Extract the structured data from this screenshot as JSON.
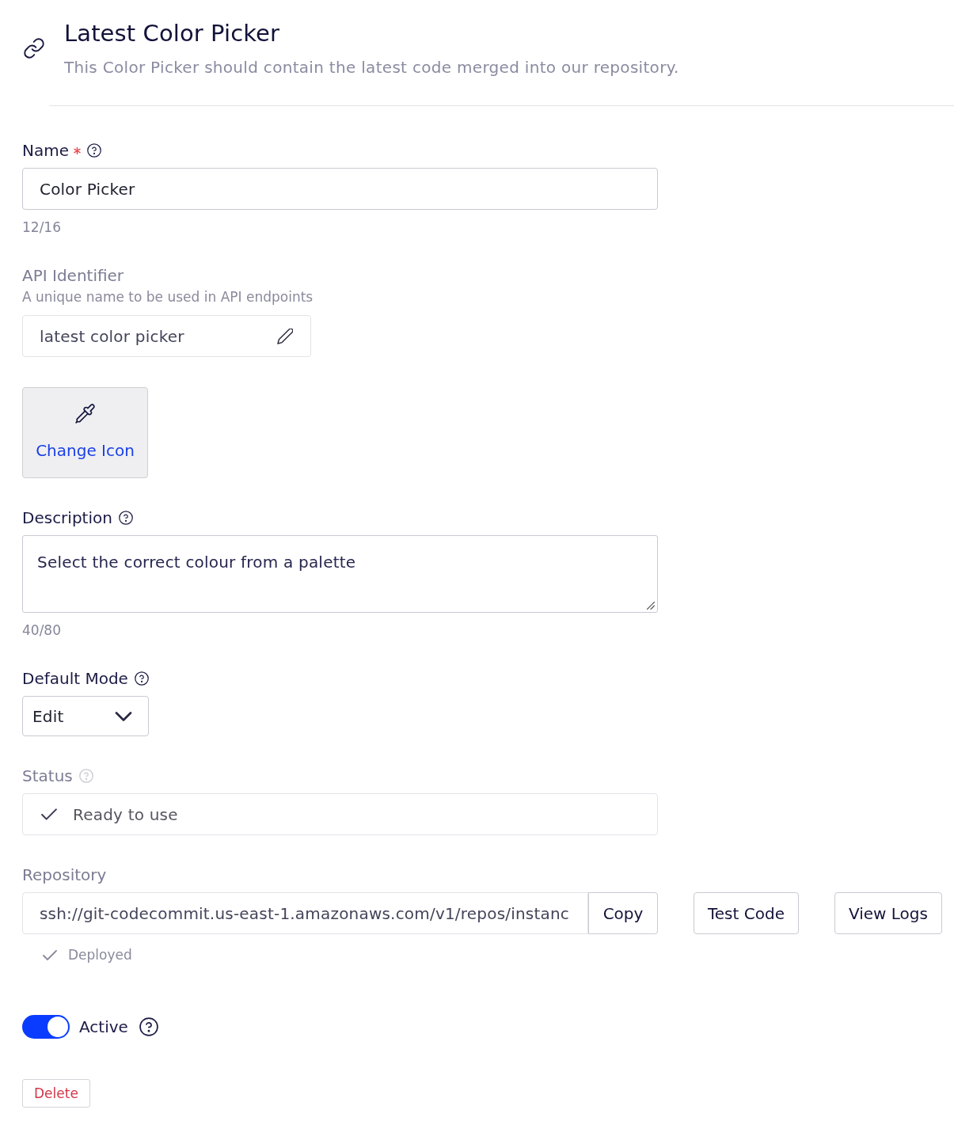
{
  "header": {
    "title": "Latest Color Picker",
    "subtitle": "This Color Picker should contain the latest code merged into our repository."
  },
  "form": [
    {
      "kind": "text",
      "label": "Name",
      "required": true,
      "help": true,
      "disabled": false,
      "value": "Color Picker",
      "counter": "12/16"
    },
    {
      "kind": "identifier",
      "label": "API Identifier",
      "required": false,
      "help": false,
      "disabled": true,
      "hint": "A unique name to be used in API endpoints",
      "value": "latest color picker"
    },
    {
      "kind": "icon_picker",
      "button": "Change Icon"
    },
    {
      "kind": "textarea",
      "label": "Description",
      "required": false,
      "help": true,
      "disabled": false,
      "value": "Select the correct colour from a palette",
      "counter": "40/80"
    },
    {
      "kind": "select",
      "label": "Default Mode",
      "required": false,
      "help": true,
      "disabled": false,
      "value": "Edit"
    },
    {
      "kind": "status",
      "label": "Status",
      "required": false,
      "help": true,
      "disabled": true,
      "value": "Ready to use"
    },
    {
      "kind": "repository",
      "label": "Repository",
      "required": false,
      "help": false,
      "disabled": true,
      "value": "ssh://git-codecommit.us-east-1.amazonaws.com/v1/repos/instanc",
      "copy_button": "Copy",
      "actions": [
        "Test Code",
        "View Logs"
      ],
      "deployment": "Deployed"
    },
    {
      "kind": "toggle",
      "label": "Active",
      "on": true,
      "help": true
    },
    {
      "kind": "danger_button",
      "button": "Delete"
    }
  ]
}
